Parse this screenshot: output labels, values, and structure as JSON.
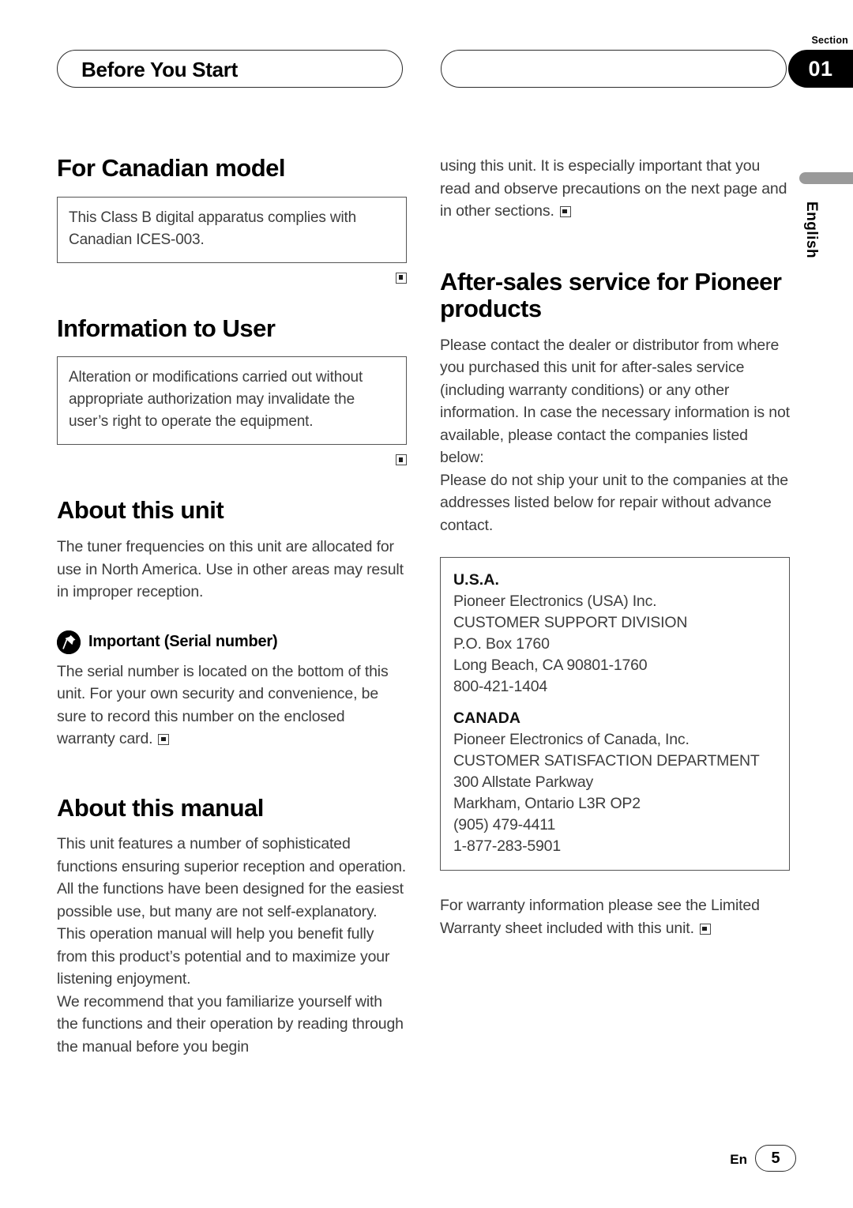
{
  "header": {
    "left_pill_title": "Before You Start",
    "right_pill_title": "",
    "section_label": "Section",
    "section_number": "01"
  },
  "side_tab": {
    "language": "English"
  },
  "left_column": {
    "canadian_model": {
      "heading": "For Canadian model",
      "notice": "This Class B digital apparatus complies with Canadian ICES-003."
    },
    "information_to_user": {
      "heading": "Information to User",
      "notice": "Alteration or modifications carried out without appropriate authorization may invalidate the user’s right to operate the equipment."
    },
    "about_this_unit": {
      "heading": "About this unit",
      "paragraph": "The tuner frequencies on this unit are allocated for use in North America. Use in other areas may result in improper reception.",
      "important_icon": "pushpin-icon",
      "important_label": "Important (Serial number)",
      "important_paragraph": "The serial number is located on the bottom of this unit. For your own security and convenience, be sure to record this number on the enclosed warranty card."
    },
    "about_this_manual": {
      "heading": "About this manual",
      "paragraph_1": "This unit features a number of sophisticated functions ensuring superior reception and operation. All the functions have been designed for the easiest possible use, but many are not self-explanatory. This operation manual will help you benefit fully from this product’s potential and to maximize your listening enjoyment.",
      "paragraph_2": "We recommend that you familiarize yourself with the functions and their operation by reading through the manual before you begin"
    }
  },
  "right_column": {
    "continued_paragraph": "using this unit. It is especially important that you read and observe precautions on the next page and in other sections.",
    "after_sales": {
      "heading": "After-sales service for Pioneer products",
      "paragraph_1": "Please contact the dealer or distributor from where you purchased this unit for after-sales service (including warranty conditions) or any other information. In case the necessary information is not available, please contact the companies listed below:",
      "paragraph_2": "Please do not ship your unit to the companies at the addresses listed below for repair without advance contact."
    },
    "addresses": [
      {
        "country": "U.S.A.",
        "lines": [
          "Pioneer Electronics (USA) Inc.",
          "CUSTOMER SUPPORT DIVISION",
          "P.O. Box 1760",
          "Long Beach, CA 90801-1760",
          "800-421-1404"
        ]
      },
      {
        "country": "CANADA",
        "lines": [
          "Pioneer Electronics of Canada, Inc.",
          "CUSTOMER SATISFACTION DEPARTMENT",
          "300 Allstate Parkway",
          "Markham, Ontario L3R OP2",
          "(905) 479-4411",
          "1-877-283-5901"
        ]
      }
    ],
    "warranty_note": "For warranty information please see the Limited Warranty sheet included with this unit."
  },
  "footer": {
    "language_code": "En",
    "page_number": "5"
  },
  "colors": {
    "ink": "#000000",
    "body_text": "#3d3d3d",
    "rule": "#555555",
    "badge_background": "#000000",
    "lang_bar": "#9a9a9a"
  }
}
